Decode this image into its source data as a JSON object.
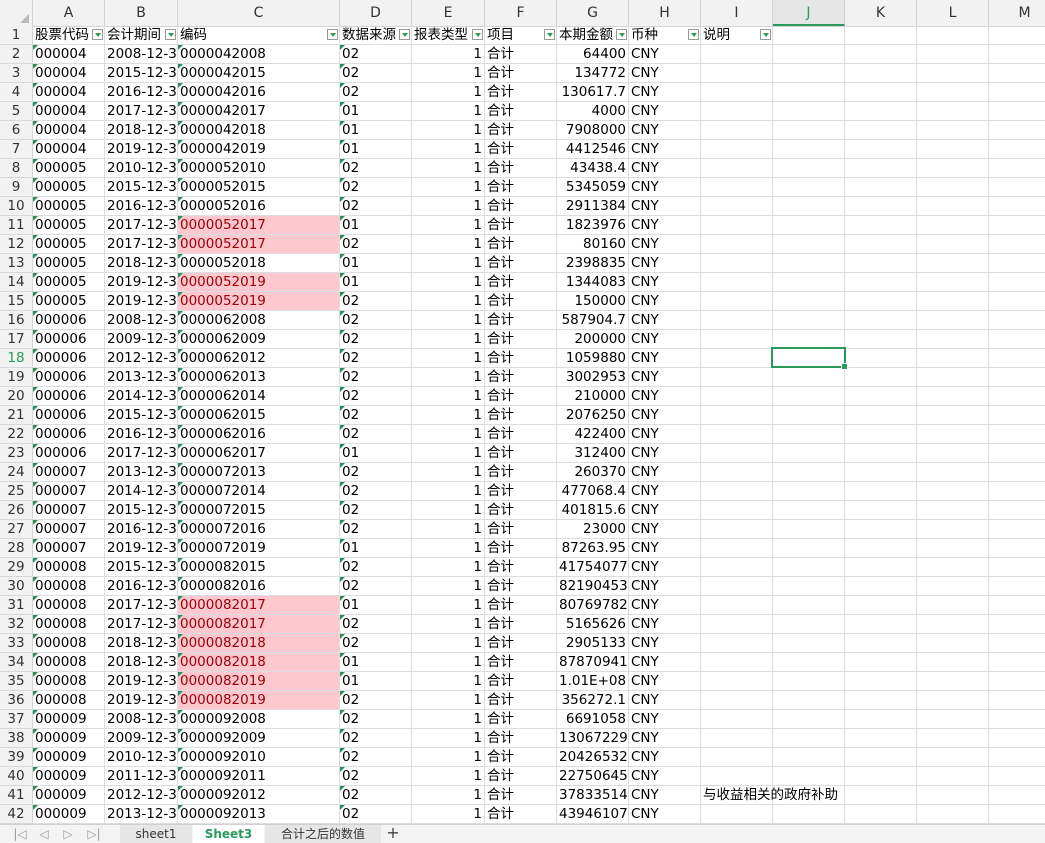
{
  "columns": [
    "A",
    "B",
    "C",
    "D",
    "E",
    "F",
    "G",
    "H",
    "I",
    "J",
    "K",
    "L",
    "M"
  ],
  "header": {
    "cells": [
      "股票代码",
      "会计期间",
      "编码",
      "数据来源",
      "报表类型",
      "项目",
      "本期金额",
      "币种",
      "说明"
    ],
    "visible": [
      "股票代码",
      "会计期间",
      "编码",
      "数据来源",
      "报表类型",
      "项目",
      "本期金额",
      "币种",
      "说明"
    ]
  },
  "active_cell": "J18",
  "active_row": 18,
  "active_column": "J",
  "highlight_color": "#ffc7ce",
  "accent_color": "#2a9a5a",
  "rows": [
    {
      "n": 2,
      "a": "000004",
      "b": "2008-12-3",
      "c": "0000042008",
      "d": "02",
      "e": "1",
      "f": "合计",
      "g": "64400",
      "h": "CNY",
      "i": "",
      "hl": false
    },
    {
      "n": 3,
      "a": "000004",
      "b": "2015-12-3",
      "c": "0000042015",
      "d": "02",
      "e": "1",
      "f": "合计",
      "g": "134772",
      "h": "CNY",
      "i": "",
      "hl": false
    },
    {
      "n": 4,
      "a": "000004",
      "b": "2016-12-3",
      "c": "0000042016",
      "d": "02",
      "e": "1",
      "f": "合计",
      "g": "130617.7",
      "h": "CNY",
      "i": "",
      "hl": false
    },
    {
      "n": 5,
      "a": "000004",
      "b": "2017-12-3",
      "c": "0000042017",
      "d": "01",
      "e": "1",
      "f": "合计",
      "g": "4000",
      "h": "CNY",
      "i": "",
      "hl": false
    },
    {
      "n": 6,
      "a": "000004",
      "b": "2018-12-3",
      "c": "0000042018",
      "d": "01",
      "e": "1",
      "f": "合计",
      "g": "7908000",
      "h": "CNY",
      "i": "",
      "hl": false
    },
    {
      "n": 7,
      "a": "000004",
      "b": "2019-12-3",
      "c": "0000042019",
      "d": "01",
      "e": "1",
      "f": "合计",
      "g": "4412546",
      "h": "CNY",
      "i": "",
      "hl": false
    },
    {
      "n": 8,
      "a": "000005",
      "b": "2010-12-3",
      "c": "0000052010",
      "d": "02",
      "e": "1",
      "f": "合计",
      "g": "43438.4",
      "h": "CNY",
      "i": "",
      "hl": false
    },
    {
      "n": 9,
      "a": "000005",
      "b": "2015-12-3",
      "c": "0000052015",
      "d": "02",
      "e": "1",
      "f": "合计",
      "g": "5345059",
      "h": "CNY",
      "i": "",
      "hl": false
    },
    {
      "n": 10,
      "a": "000005",
      "b": "2016-12-3",
      "c": "0000052016",
      "d": "02",
      "e": "1",
      "f": "合计",
      "g": "2911384",
      "h": "CNY",
      "i": "",
      "hl": false
    },
    {
      "n": 11,
      "a": "000005",
      "b": "2017-12-3",
      "c": "0000052017",
      "d": "01",
      "e": "1",
      "f": "合计",
      "g": "1823976",
      "h": "CNY",
      "i": "",
      "hl": true
    },
    {
      "n": 12,
      "a": "000005",
      "b": "2017-12-3",
      "c": "0000052017",
      "d": "02",
      "e": "1",
      "f": "合计",
      "g": "80160",
      "h": "CNY",
      "i": "",
      "hl": true
    },
    {
      "n": 13,
      "a": "000005",
      "b": "2018-12-3",
      "c": "0000052018",
      "d": "01",
      "e": "1",
      "f": "合计",
      "g": "2398835",
      "h": "CNY",
      "i": "",
      "hl": false
    },
    {
      "n": 14,
      "a": "000005",
      "b": "2019-12-3",
      "c": "0000052019",
      "d": "01",
      "e": "1",
      "f": "合计",
      "g": "1344083",
      "h": "CNY",
      "i": "",
      "hl": true
    },
    {
      "n": 15,
      "a": "000005",
      "b": "2019-12-3",
      "c": "0000052019",
      "d": "02",
      "e": "1",
      "f": "合计",
      "g": "150000",
      "h": "CNY",
      "i": "",
      "hl": true
    },
    {
      "n": 16,
      "a": "000006",
      "b": "2008-12-3",
      "c": "0000062008",
      "d": "02",
      "e": "1",
      "f": "合计",
      "g": "587904.7",
      "h": "CNY",
      "i": "",
      "hl": false
    },
    {
      "n": 17,
      "a": "000006",
      "b": "2009-12-3",
      "c": "0000062009",
      "d": "02",
      "e": "1",
      "f": "合计",
      "g": "200000",
      "h": "CNY",
      "i": "",
      "hl": false
    },
    {
      "n": 18,
      "a": "000006",
      "b": "2012-12-3",
      "c": "0000062012",
      "d": "02",
      "e": "1",
      "f": "合计",
      "g": "1059880",
      "h": "CNY",
      "i": "",
      "hl": false
    },
    {
      "n": 19,
      "a": "000006",
      "b": "2013-12-3",
      "c": "0000062013",
      "d": "02",
      "e": "1",
      "f": "合计",
      "g": "3002953",
      "h": "CNY",
      "i": "",
      "hl": false
    },
    {
      "n": 20,
      "a": "000006",
      "b": "2014-12-3",
      "c": "0000062014",
      "d": "02",
      "e": "1",
      "f": "合计",
      "g": "210000",
      "h": "CNY",
      "i": "",
      "hl": false
    },
    {
      "n": 21,
      "a": "000006",
      "b": "2015-12-3",
      "c": "0000062015",
      "d": "02",
      "e": "1",
      "f": "合计",
      "g": "2076250",
      "h": "CNY",
      "i": "",
      "hl": false
    },
    {
      "n": 22,
      "a": "000006",
      "b": "2016-12-3",
      "c": "0000062016",
      "d": "02",
      "e": "1",
      "f": "合计",
      "g": "422400",
      "h": "CNY",
      "i": "",
      "hl": false
    },
    {
      "n": 23,
      "a": "000006",
      "b": "2017-12-3",
      "c": "0000062017",
      "d": "01",
      "e": "1",
      "f": "合计",
      "g": "312400",
      "h": "CNY",
      "i": "",
      "hl": false
    },
    {
      "n": 24,
      "a": "000007",
      "b": "2013-12-3",
      "c": "0000072013",
      "d": "02",
      "e": "1",
      "f": "合计",
      "g": "260370",
      "h": "CNY",
      "i": "",
      "hl": false
    },
    {
      "n": 25,
      "a": "000007",
      "b": "2014-12-3",
      "c": "0000072014",
      "d": "02",
      "e": "1",
      "f": "合计",
      "g": "477068.4",
      "h": "CNY",
      "i": "",
      "hl": false
    },
    {
      "n": 26,
      "a": "000007",
      "b": "2015-12-3",
      "c": "0000072015",
      "d": "02",
      "e": "1",
      "f": "合计",
      "g": "401815.6",
      "h": "CNY",
      "i": "",
      "hl": false
    },
    {
      "n": 27,
      "a": "000007",
      "b": "2016-12-3",
      "c": "0000072016",
      "d": "02",
      "e": "1",
      "f": "合计",
      "g": "23000",
      "h": "CNY",
      "i": "",
      "hl": false
    },
    {
      "n": 28,
      "a": "000007",
      "b": "2019-12-3",
      "c": "0000072019",
      "d": "01",
      "e": "1",
      "f": "合计",
      "g": "87263.95",
      "h": "CNY",
      "i": "",
      "hl": false
    },
    {
      "n": 29,
      "a": "000008",
      "b": "2015-12-3",
      "c": "0000082015",
      "d": "02",
      "e": "1",
      "f": "合计",
      "g": "41754077",
      "h": "CNY",
      "i": "",
      "hl": false
    },
    {
      "n": 30,
      "a": "000008",
      "b": "2016-12-3",
      "c": "0000082016",
      "d": "02",
      "e": "1",
      "f": "合计",
      "g": "82190453",
      "h": "CNY",
      "i": "",
      "hl": false
    },
    {
      "n": 31,
      "a": "000008",
      "b": "2017-12-3",
      "c": "0000082017",
      "d": "01",
      "e": "1",
      "f": "合计",
      "g": "80769782",
      "h": "CNY",
      "i": "",
      "hl": true
    },
    {
      "n": 32,
      "a": "000008",
      "b": "2017-12-3",
      "c": "0000082017",
      "d": "02",
      "e": "1",
      "f": "合计",
      "g": "5165626",
      "h": "CNY",
      "i": "",
      "hl": true
    },
    {
      "n": 33,
      "a": "000008",
      "b": "2018-12-3",
      "c": "0000082018",
      "d": "02",
      "e": "1",
      "f": "合计",
      "g": "2905133",
      "h": "CNY",
      "i": "",
      "hl": true
    },
    {
      "n": 34,
      "a": "000008",
      "b": "2018-12-3",
      "c": "0000082018",
      "d": "01",
      "e": "1",
      "f": "合计",
      "g": "87870941",
      "h": "CNY",
      "i": "",
      "hl": true
    },
    {
      "n": 35,
      "a": "000008",
      "b": "2019-12-3",
      "c": "0000082019",
      "d": "01",
      "e": "1",
      "f": "合计",
      "g": "1.01E+08",
      "h": "CNY",
      "i": "",
      "hl": true
    },
    {
      "n": 36,
      "a": "000008",
      "b": "2019-12-3",
      "c": "0000082019",
      "d": "02",
      "e": "1",
      "f": "合计",
      "g": "356272.1",
      "h": "CNY",
      "i": "",
      "hl": true
    },
    {
      "n": 37,
      "a": "000009",
      "b": "2008-12-3",
      "c": "0000092008",
      "d": "02",
      "e": "1",
      "f": "合计",
      "g": "6691058",
      "h": "CNY",
      "i": "",
      "hl": false
    },
    {
      "n": 38,
      "a": "000009",
      "b": "2009-12-3",
      "c": "0000092009",
      "d": "02",
      "e": "1",
      "f": "合计",
      "g": "13067229",
      "h": "CNY",
      "i": "",
      "hl": false
    },
    {
      "n": 39,
      "a": "000009",
      "b": "2010-12-3",
      "c": "0000092010",
      "d": "02",
      "e": "1",
      "f": "合计",
      "g": "20426532",
      "h": "CNY",
      "i": "",
      "hl": false
    },
    {
      "n": 40,
      "a": "000009",
      "b": "2011-12-3",
      "c": "0000092011",
      "d": "02",
      "e": "1",
      "f": "合计",
      "g": "22750645",
      "h": "CNY",
      "i": "",
      "hl": false
    },
    {
      "n": 41,
      "a": "000009",
      "b": "2012-12-3",
      "c": "0000092012",
      "d": "02",
      "e": "1",
      "f": "合计",
      "g": "37833514",
      "h": "CNY",
      "i": "与收益相关的政府补助",
      "hl": false
    },
    {
      "n": 42,
      "a": "000009",
      "b": "2013-12-3",
      "c": "0000092013",
      "d": "02",
      "e": "1",
      "f": "合计",
      "g": "43946107",
      "h": "CNY",
      "i": "",
      "hl": false
    }
  ],
  "sheet_tabs": [
    {
      "label": "sheet1",
      "active": false
    },
    {
      "label": "Sheet3",
      "active": true
    },
    {
      "label": "合计之后的数值",
      "active": false
    }
  ],
  "nav_icons": [
    "first-sheet-icon",
    "prev-sheet-icon",
    "next-sheet-icon",
    "last-sheet-icon"
  ],
  "add_sheet_icon": "plus-icon"
}
